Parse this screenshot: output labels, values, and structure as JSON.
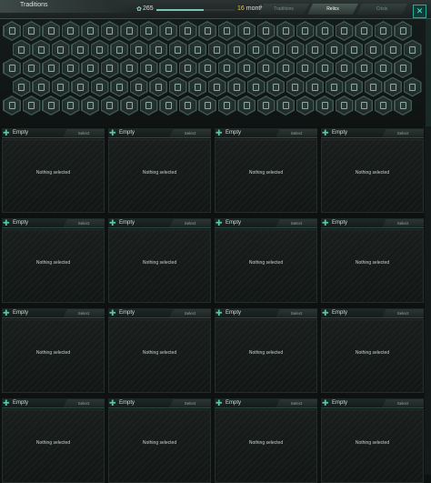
{
  "header": {
    "title": "Traditions",
    "resource_value": "265",
    "resource_icon": "unity-icon",
    "duration_number": "16",
    "duration_unit": "months",
    "duration_progress": 0.6,
    "tabs": [
      {
        "label": "Traditions",
        "active": false
      },
      {
        "label": "Relics",
        "active": true
      },
      {
        "label": "Crisis",
        "active": false
      }
    ],
    "close_icon": "close-icon"
  },
  "colors": {
    "accent": "#2aa894",
    "highlight": "#e8c45a",
    "background": "#0d1211"
  },
  "hex_grid": {
    "rows": 5,
    "cols": 22,
    "icon": "locked-tradition-icon"
  },
  "cards": [
    {
      "title": "Empty",
      "select_label": "Select",
      "body": "Nothing selected"
    },
    {
      "title": "Empty",
      "select_label": "Select",
      "body": "Nothing selected"
    },
    {
      "title": "Empty",
      "select_label": "Select",
      "body": "Nothing selected"
    },
    {
      "title": "Empty",
      "select_label": "Select",
      "body": "Nothing selected"
    },
    {
      "title": "Empty",
      "select_label": "Select",
      "body": "Nothing selected"
    },
    {
      "title": "Empty",
      "select_label": "Select",
      "body": "Nothing selected"
    },
    {
      "title": "Empty",
      "select_label": "Select",
      "body": "Nothing selected"
    },
    {
      "title": "Empty",
      "select_label": "Select",
      "body": "Nothing selected"
    },
    {
      "title": "Empty",
      "select_label": "Select",
      "body": "Nothing selected"
    },
    {
      "title": "Empty",
      "select_label": "Select",
      "body": "Nothing selected"
    },
    {
      "title": "Empty",
      "select_label": "Select",
      "body": "Nothing selected"
    },
    {
      "title": "Empty",
      "select_label": "Select",
      "body": "Nothing selected"
    },
    {
      "title": "Empty",
      "select_label": "Select",
      "body": "Nothing selected"
    },
    {
      "title": "Empty",
      "select_label": "Select",
      "body": "Nothing selected"
    },
    {
      "title": "Empty",
      "select_label": "Select",
      "body": "Nothing selected"
    },
    {
      "title": "Empty",
      "select_label": "Select",
      "body": "Nothing selected"
    }
  ]
}
